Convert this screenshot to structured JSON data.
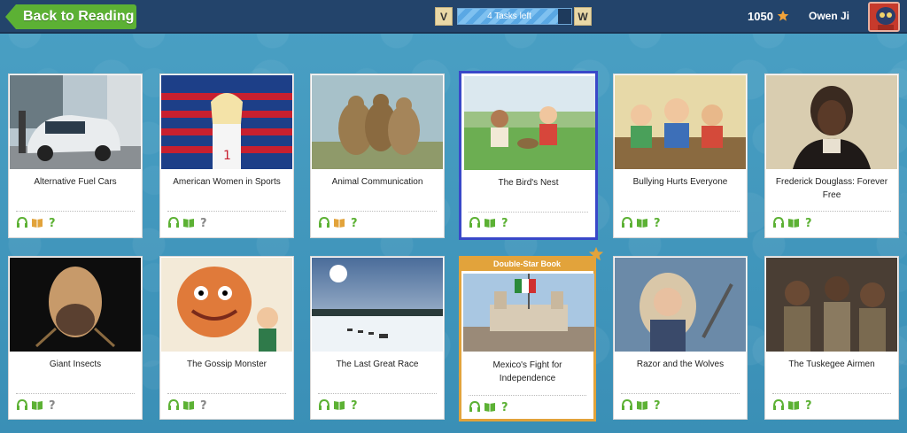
{
  "header": {
    "back_label": "Back to Reading",
    "level_left": "V",
    "level_right": "W",
    "tasks_label": "4 Tasks left",
    "tasks_progress_fraction": 0.88,
    "stars": "1050",
    "user_name": "Owen Ji"
  },
  "colors": {
    "topbar": "#23446b",
    "back_button": "#5cb134",
    "selected_border": "#3948c9",
    "double_star": "#e2a33b",
    "icon_green": "#5cb134"
  },
  "books": [
    {
      "title": "Alternative Fuel Cars",
      "icons": [
        "listen-icon",
        "read-icon-orange",
        "quiz-icon-green"
      ]
    },
    {
      "title": "American Women in Sports",
      "icons": [
        "listen-icon",
        "read-icon",
        "quiz-icon-gray"
      ]
    },
    {
      "title": "Animal Communication",
      "icons": [
        "listen-icon",
        "read-icon-orange",
        "quiz-icon-green"
      ]
    },
    {
      "title": "The Bird's Nest",
      "icons": [
        "listen-icon",
        "read-icon",
        "quiz-icon-green"
      ],
      "selected": true
    },
    {
      "title": "Bullying Hurts Everyone",
      "icons": [
        "listen-icon",
        "read-icon",
        "quiz-icon-green"
      ]
    },
    {
      "title": "Frederick Douglass: Forever Free",
      "icons": [
        "listen-icon",
        "read-icon",
        "quiz-icon-green"
      ]
    },
    {
      "title": "Giant Insects",
      "icons": [
        "listen-icon",
        "read-icon",
        "quiz-icon-gray"
      ]
    },
    {
      "title": "The Gossip Monster",
      "icons": [
        "listen-icon",
        "read-icon",
        "quiz-icon-gray"
      ]
    },
    {
      "title": "The Last Great Race",
      "icons": [
        "listen-icon",
        "read-icon",
        "quiz-icon-green"
      ]
    },
    {
      "title": "Mexico's Fight for Independence",
      "icons": [
        "listen-icon",
        "read-icon",
        "quiz-icon-green"
      ],
      "banner": "Double-Star Book"
    },
    {
      "title": "Razor and the Wolves",
      "icons": [
        "listen-icon",
        "read-icon",
        "quiz-icon-green"
      ]
    },
    {
      "title": "The Tuskegee Airmen",
      "icons": [
        "listen-icon",
        "read-icon",
        "quiz-icon-green"
      ]
    }
  ]
}
